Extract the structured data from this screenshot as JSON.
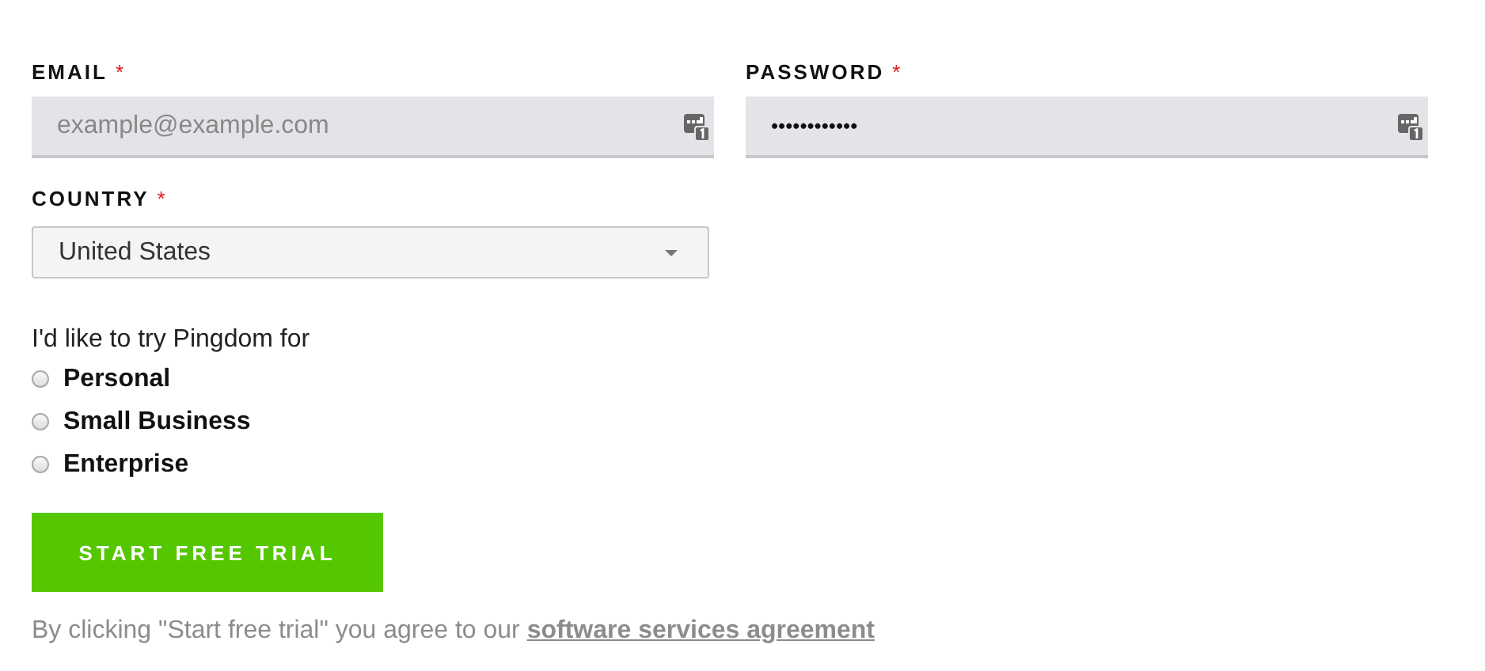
{
  "fields": [
    {
      "label": "EMAIL",
      "required_mark": "*",
      "placeholder": "example@example.com"
    },
    {
      "label": "PASSWORD",
      "required_mark": "*",
      "value": "••••••••••••"
    }
  ],
  "country": {
    "label": "COUNTRY",
    "required_mark": "*",
    "value": "United States"
  },
  "plan": {
    "prompt": "I'd like to try Pingdom for",
    "options": [
      {
        "label": "Personal",
        "selected": false
      },
      {
        "label": "Small Business",
        "selected": false
      },
      {
        "label": "Enterprise",
        "selected": false
      }
    ]
  },
  "button": "START FREE TRIAL",
  "terms": {
    "text": "By clicking \"Start free trial\" you agree to our",
    "link": "software services agreement"
  }
}
